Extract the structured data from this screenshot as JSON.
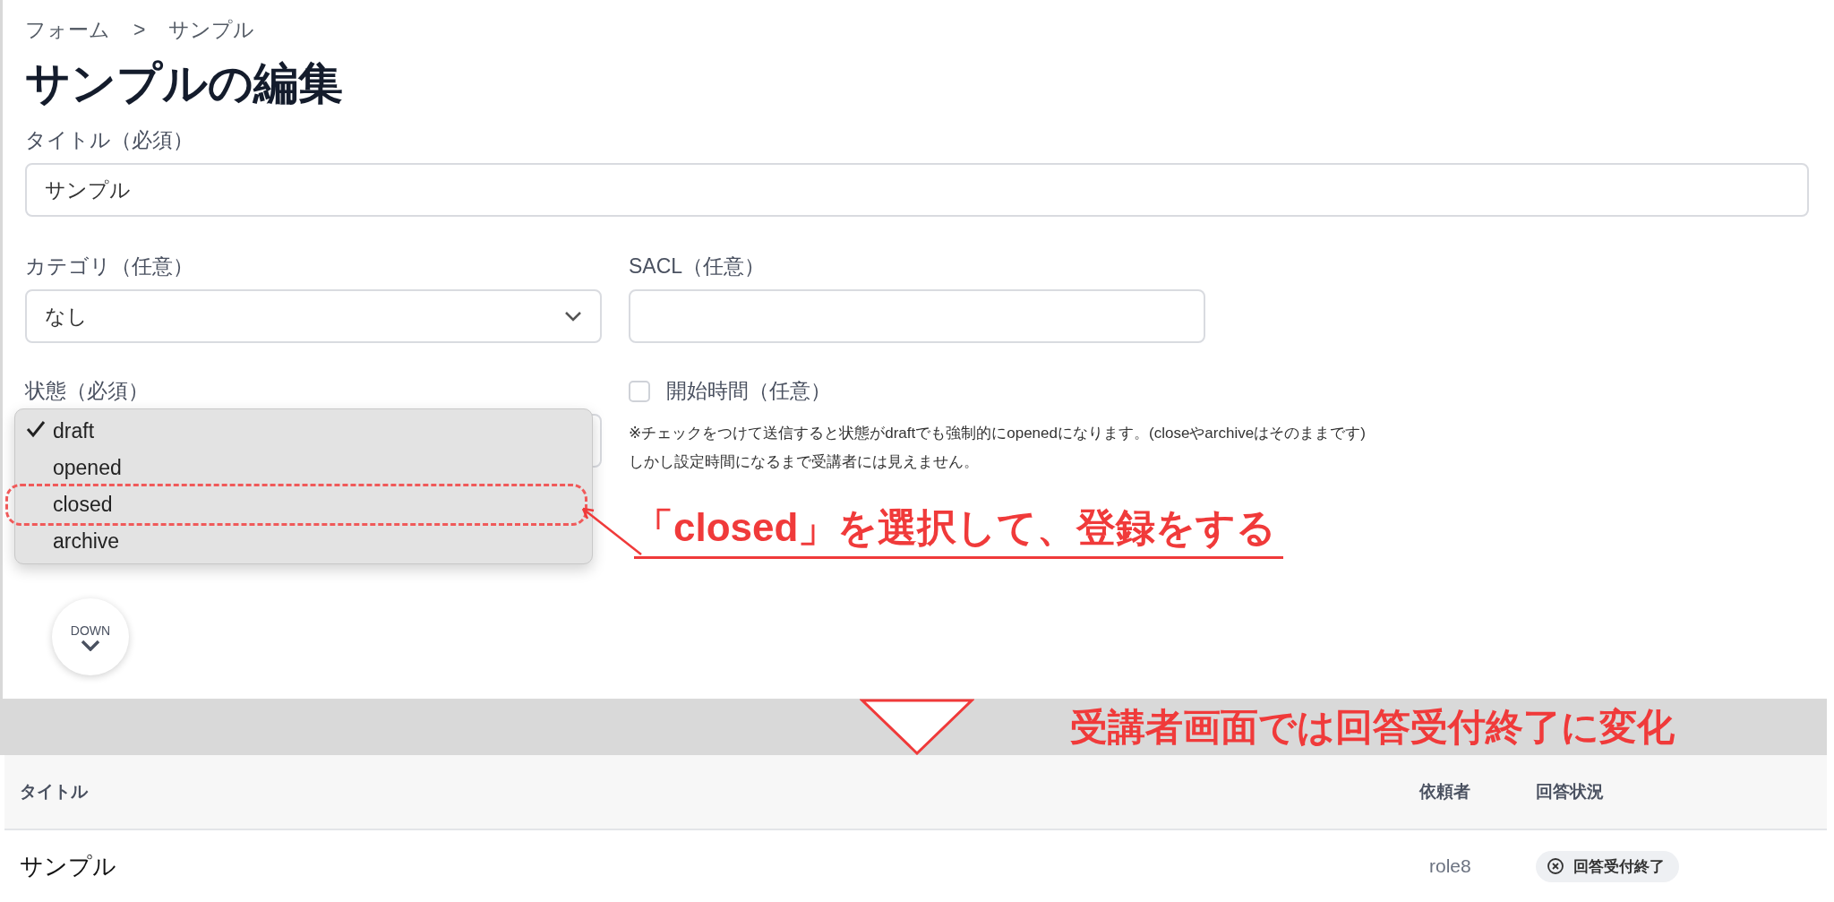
{
  "breadcrumb": {
    "items": [
      "フォーム",
      "サンプル"
    ],
    "separator": ">"
  },
  "heading": "サンプルの編集",
  "title_field": {
    "label": "タイトル（必須）",
    "value": "サンプル"
  },
  "category_field": {
    "label": "カテゴリ（任意）",
    "value": "なし"
  },
  "sacl_field": {
    "label": "SACL（任意）"
  },
  "status_field": {
    "label": "状態（必須）",
    "options": [
      {
        "label": "draft",
        "selected": true,
        "circled": false
      },
      {
        "label": "opened",
        "selected": false,
        "circled": false
      },
      {
        "label": "closed",
        "selected": false,
        "circled": true
      },
      {
        "label": "archive",
        "selected": false,
        "circled": false
      }
    ]
  },
  "start_time": {
    "label": "開始時間（任意）",
    "checked": false,
    "note_lines": [
      "※チェックをつけて送信すると状態がdraftでも強制的にopenedになります。(closeやarchiveはそのままです)",
      "しかし設定時間になるまで受講者には見えません。"
    ]
  },
  "down_button": "DOWN",
  "annotations": [
    "「closed」を選択して、登録をする",
    "受講者画面では回答受付終了に変化"
  ],
  "table": {
    "columns": [
      "タイトル",
      "依頼者",
      "回答状況"
    ],
    "rows": [
      {
        "title": "サンプル",
        "requester": "role8",
        "status": "回答受付終了"
      }
    ]
  }
}
